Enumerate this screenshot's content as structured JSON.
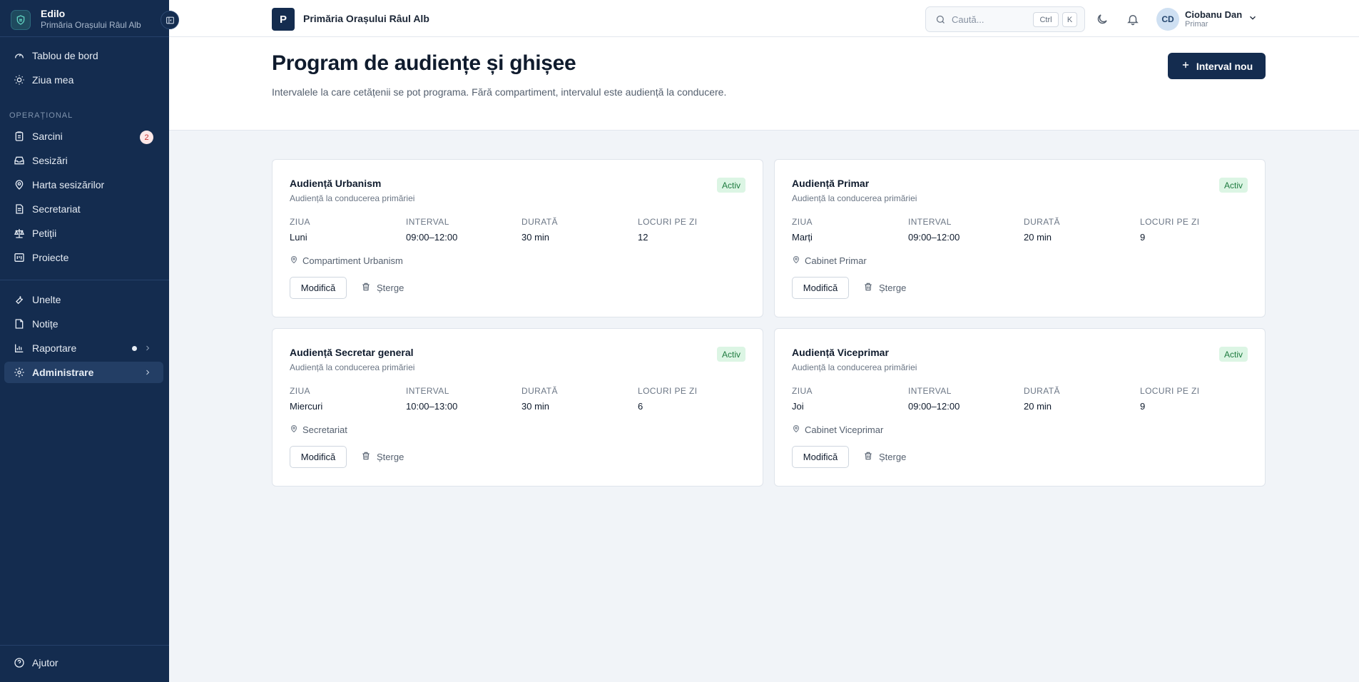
{
  "brand": {
    "title": "Edilo",
    "subtitle": "Primăria Orașului Râul Alb"
  },
  "sidebar": {
    "items_top": [
      {
        "label": "Tablou de bord",
        "icon": "gauge-icon"
      },
      {
        "label": "Ziua mea",
        "icon": "sun-icon"
      }
    ],
    "section_label": "OPERAȚIONAL",
    "items_ops": [
      {
        "label": "Sarcini",
        "icon": "clipboard-icon",
        "badge": "2"
      },
      {
        "label": "Sesizări",
        "icon": "inbox-icon"
      },
      {
        "label": "Harta sesizărilor",
        "icon": "map-pin-icon"
      },
      {
        "label": "Secretariat",
        "icon": "document-icon"
      },
      {
        "label": "Petiții",
        "icon": "scale-icon"
      },
      {
        "label": "Proiecte",
        "icon": "kanban-icon"
      }
    ],
    "items_tools": [
      {
        "label": "Unelte",
        "icon": "wrench-icon"
      },
      {
        "label": "Notițe",
        "icon": "note-icon"
      },
      {
        "label": "Raportare",
        "icon": "bar-chart-icon"
      },
      {
        "label": "Administrare",
        "icon": "gear-icon"
      }
    ],
    "help_label": "Ajutor"
  },
  "topbar": {
    "org_initial": "P",
    "org_name": "Primăria Orașului Râul Alb",
    "search_placeholder": "Caută...",
    "kbd_ctrl": "Ctrl",
    "kbd_k": "K",
    "user": {
      "initials": "CD",
      "name": "Ciobanu Dan",
      "role": "Primar"
    }
  },
  "page": {
    "title": "Program de audiențe și ghișee",
    "description": "Intervalele la care cetățenii se pot programa. Fără compartiment, intervalul este audiență la conducere.",
    "new_button": "Interval nou"
  },
  "labels": {
    "day": "ZIUA",
    "interval": "INTERVAL",
    "duration": "DURATĂ",
    "slots": "LOCURI PE ZI",
    "edit": "Modifică",
    "delete": "Șterge"
  },
  "cards": [
    {
      "title": "Audiență Urbanism",
      "subtitle": "Audiență la conducerea primăriei",
      "status": "Activ",
      "day": "Luni",
      "interval": "09:00–12:00",
      "duration": "30 min",
      "slots": "12",
      "location": "Compartiment Urbanism"
    },
    {
      "title": "Audiență Primar",
      "subtitle": "Audiență la conducerea primăriei",
      "status": "Activ",
      "day": "Marți",
      "interval": "09:00–12:00",
      "duration": "20 min",
      "slots": "9",
      "location": "Cabinet Primar"
    },
    {
      "title": "Audiență Secretar general",
      "subtitle": "Audiență la conducerea primăriei",
      "status": "Activ",
      "day": "Miercuri",
      "interval": "10:00–13:00",
      "duration": "30 min",
      "slots": "6",
      "location": "Secretariat"
    },
    {
      "title": "Audiență Viceprimar",
      "subtitle": "Audiență la conducerea primăriei",
      "status": "Activ",
      "day": "Joi",
      "interval": "09:00–12:00",
      "duration": "20 min",
      "slots": "9",
      "location": "Cabinet Viceprimar"
    }
  ],
  "colors": {
    "sidebar": "#142c4f",
    "accent": "#142c4f",
    "status_bg": "#dcf5e4",
    "status_text": "#1d7a3e",
    "badge_text": "#c53030"
  }
}
